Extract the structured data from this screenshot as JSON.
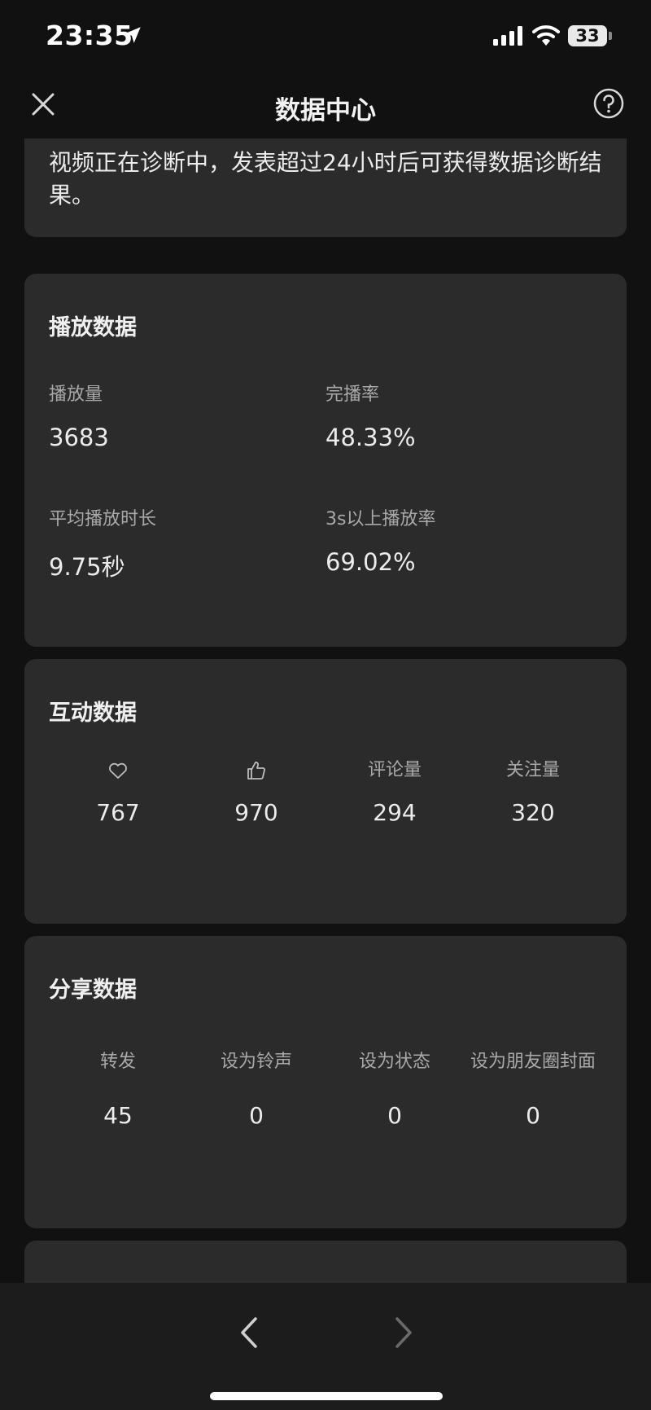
{
  "status": {
    "time": "23:35",
    "battery": "33"
  },
  "nav": {
    "title": "数据中心"
  },
  "diagnosis": {
    "text": "视频正在诊断中，发表超过24小时后可获得数据诊断结果。"
  },
  "play": {
    "title": "播放数据",
    "views_label": "播放量",
    "views": "3683",
    "completion_label": "完播率",
    "completion": "48.33%",
    "avg_label": "平均播放时长",
    "avg": "9.75秒",
    "over3s_label": "3s以上播放率",
    "over3s": "69.02%"
  },
  "interaction": {
    "title": "互动数据",
    "favorites": "767",
    "likes": "970",
    "comments_label": "评论量",
    "comments": "294",
    "follows_label": "关注量",
    "follows": "320"
  },
  "share": {
    "title": "分享数据",
    "forward_label": "转发",
    "forward": "45",
    "ringtone_label": "设为铃声",
    "ringtone": "0",
    "status_label": "设为状态",
    "status": "0",
    "moments_label": "设为朋友圈封面",
    "moments": "0"
  },
  "colors": {
    "background": "#111111",
    "card": "#2b2b2b",
    "label": "#a9a9a9",
    "text": "#ececec"
  }
}
